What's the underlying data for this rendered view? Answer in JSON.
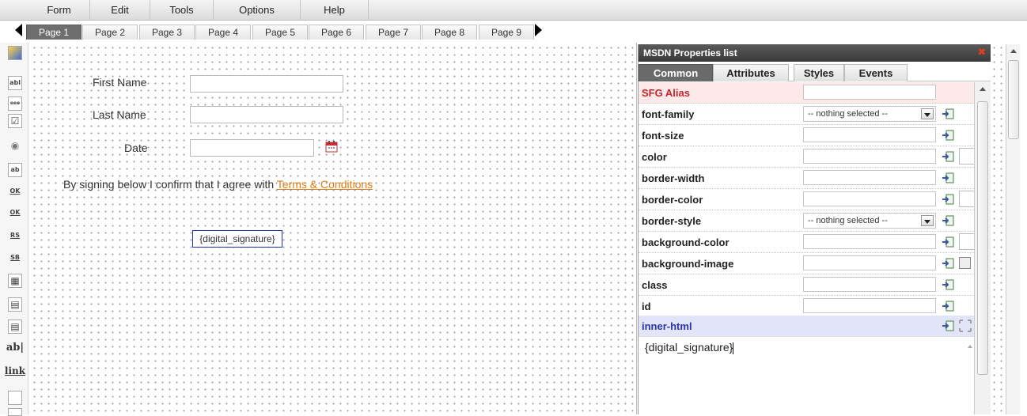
{
  "menu": {
    "items": [
      "Form",
      "Edit",
      "Tools",
      "Options",
      "Help"
    ]
  },
  "pages": {
    "tabs": [
      "Page 1",
      "Page 2",
      "Page 3",
      "Page 4",
      "Page 5",
      "Page 6",
      "Page 7",
      "Page 8",
      "Page 9"
    ],
    "active_index": 0
  },
  "toolbox": {
    "tools": [
      {
        "icon": "pointer-tool-icon",
        "glyph": ""
      },
      {
        "icon": "textbox-tool-icon",
        "glyph": "abl"
      },
      {
        "icon": "textarea-tool-icon",
        "glyph": "ееө"
      },
      {
        "icon": "checkbox-tool-icon",
        "glyph": "☑"
      },
      {
        "icon": "radio-tool-icon",
        "glyph": "◉"
      },
      {
        "icon": "listbox-tool-icon",
        "glyph": "ab"
      },
      {
        "icon": "ok-button-1-icon",
        "glyph": "OK"
      },
      {
        "icon": "ok-button-2-icon",
        "glyph": "OK"
      },
      {
        "icon": "reset-button-icon",
        "glyph": "RS"
      },
      {
        "icon": "submit-button-icon",
        "glyph": "SB"
      },
      {
        "icon": "table-tool-icon",
        "glyph": "▦"
      },
      {
        "icon": "select-tool-icon",
        "glyph": "▤"
      },
      {
        "icon": "multiselect-tool-icon",
        "glyph": "▤"
      },
      {
        "icon": "label-tool-icon",
        "glyph": "ab|"
      },
      {
        "icon": "link-tool-icon",
        "glyph": "link"
      },
      {
        "icon": "box-tool-icon",
        "glyph": ""
      },
      {
        "icon": "image-tool-icon",
        "glyph": ""
      }
    ]
  },
  "form": {
    "first_name_label": "First Name",
    "last_name_label": "Last Name",
    "date_label": "Date",
    "agreement_text": "By signing below I confirm that I agree with",
    "terms_link": "Terms & Conditions",
    "signature_placeholder": "{digital_signature}"
  },
  "properties_panel": {
    "title": "MSDN Properties list",
    "tabs": [
      "Common",
      "Attributes",
      "Styles",
      "Events"
    ],
    "active_tab": "Common",
    "rows": [
      {
        "name": "SFG Alias",
        "kind": "text",
        "value": ""
      },
      {
        "name": "font-family",
        "kind": "select",
        "value": "-- nothing selected --"
      },
      {
        "name": "font-size",
        "kind": "text",
        "value": ""
      },
      {
        "name": "color",
        "kind": "color",
        "value": ""
      },
      {
        "name": "border-width",
        "kind": "text",
        "value": ""
      },
      {
        "name": "border-color",
        "kind": "color",
        "value": ""
      },
      {
        "name": "border-style",
        "kind": "select",
        "value": "-- nothing selected --"
      },
      {
        "name": "background-color",
        "kind": "color",
        "value": ""
      },
      {
        "name": "background-image",
        "kind": "image",
        "value": ""
      },
      {
        "name": "class",
        "kind": "text",
        "value": ""
      },
      {
        "name": "id",
        "kind": "text",
        "value": ""
      },
      {
        "name": "inner-html",
        "kind": "header",
        "value": ""
      }
    ],
    "inner_html_value": "{digital_signature}"
  },
  "colors": {
    "alias_row_bg": "#fde8ea",
    "alias_text": "#c0282c",
    "inner_html_row_bg": "#e2e4f8",
    "inner_html_text": "#2a33a8",
    "terms_link": "#e07b14",
    "signature_border": "#1a2fa8"
  }
}
